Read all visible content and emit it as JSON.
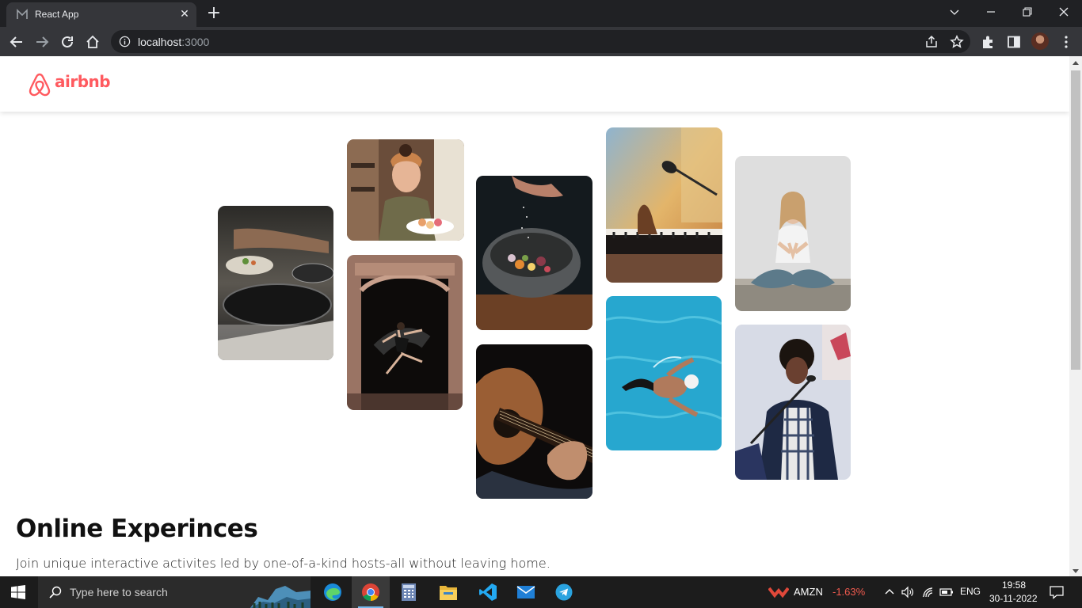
{
  "browser": {
    "tab_title": "React App",
    "url_host": "localhost",
    "url_port": ":3000"
  },
  "page": {
    "brand": "airbnb",
    "brand_color": "#FF5A5F",
    "hero_title": "Online Experinces",
    "hero_subtitle": "Join unique interactive activites led by one-of-a-kind hosts-all without leaving home.",
    "photos": [
      "cooking",
      "woman-with-macarons",
      "dancer-in-doorway",
      "food-bowl",
      "guitar",
      "piano-microphone",
      "swimmer",
      "yoga",
      "singer"
    ]
  },
  "taskbar": {
    "search_placeholder": "Type here to search",
    "stock_symbol": "AMZN",
    "stock_change": "-1.63%",
    "language": "ENG",
    "time": "19:58",
    "date": "30-11-2022"
  }
}
